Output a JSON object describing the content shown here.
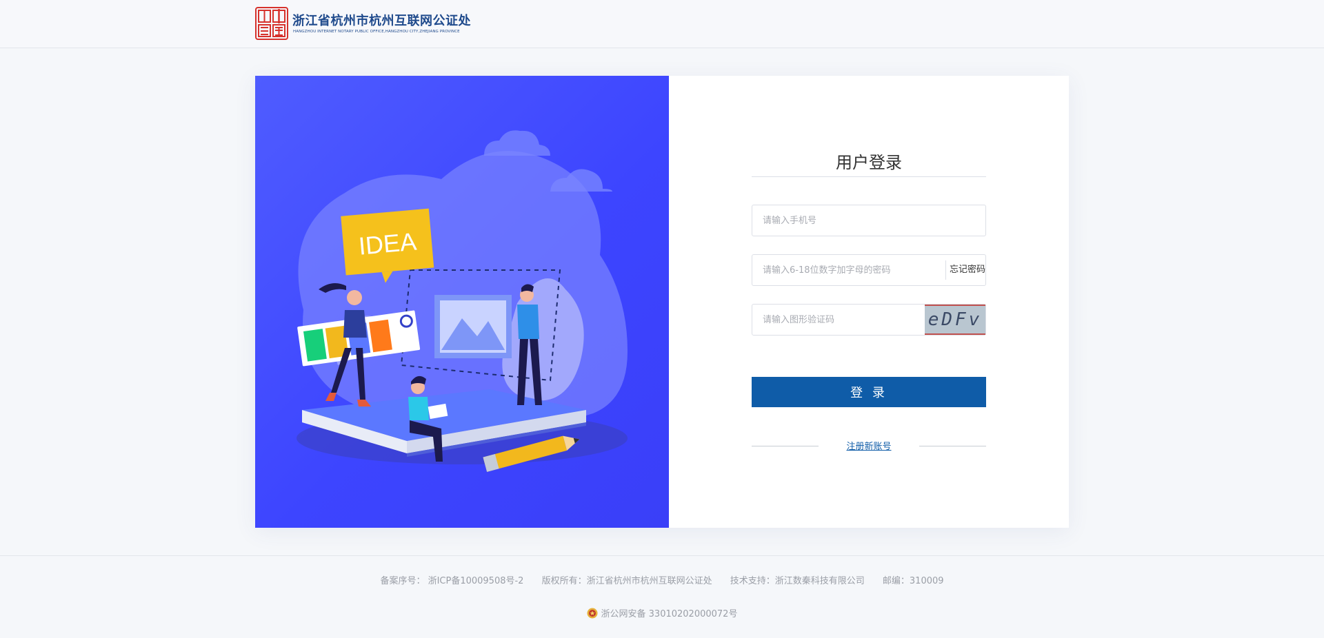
{
  "header": {
    "logo_title": "浙江省杭州市杭州互联网公证处",
    "logo_subtitle": "HANGZHOU INTERNET NOTARY PUBLIC OFFICE,HANGZHOU CITY,ZHEJIANG PROVINCE",
    "seal_icon": "seal-logo-icon",
    "seal_text": "中国公证",
    "seal_color": "#d6312b"
  },
  "illustration": {
    "idea_text": "IDEA",
    "background_color": "#3d45ff"
  },
  "login": {
    "title": "用户登录",
    "phone_placeholder": "请输入手机号",
    "password_placeholder": "请输入6-18位数字加字母的密码",
    "forgot_label": "忘记密码",
    "captcha_placeholder": "请输入图形验证码",
    "captcha_text": "eDFv",
    "submit_label": "登 录",
    "register_label": "注册新账号",
    "accent_color": "#0f5ca8"
  },
  "footer": {
    "icp": "备案序号： 浙ICP备10009508号-2",
    "copyright": "版权所有：浙江省杭州市杭州互联网公证处",
    "tech_support": "技术支持：浙江数秦科技有限公司",
    "postcode": "邮编：310009",
    "police_record": "浙公网安备 33010202000072号",
    "police_icon": "police-badge-icon"
  }
}
